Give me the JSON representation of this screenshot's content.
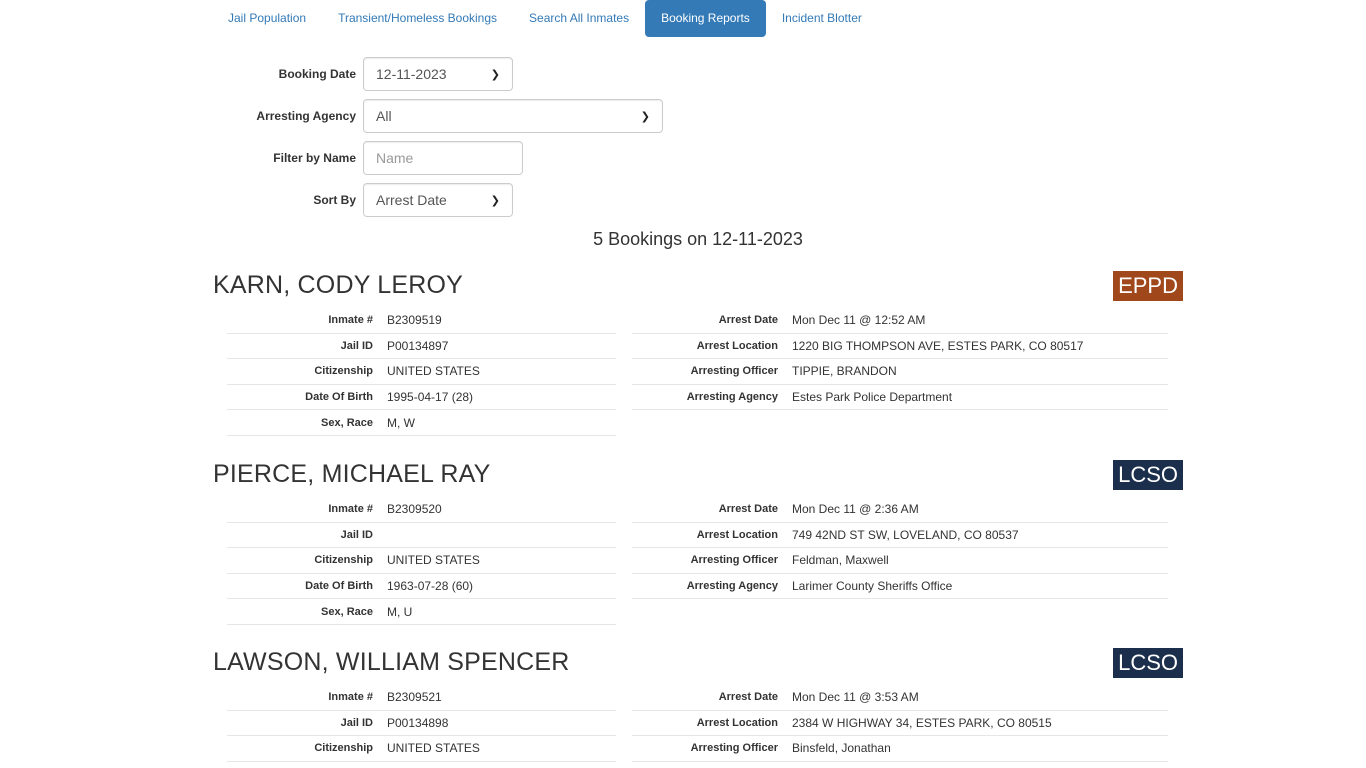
{
  "nav": {
    "tabs": [
      {
        "label": "Jail Population",
        "active": false
      },
      {
        "label": "Transient/Homeless Bookings",
        "active": false
      },
      {
        "label": "Search All Inmates",
        "active": false
      },
      {
        "label": "Booking Reports",
        "active": true
      },
      {
        "label": "Incident Blotter",
        "active": false
      }
    ]
  },
  "filters": {
    "booking_date": {
      "label": "Booking Date",
      "value": "12-11-2023"
    },
    "arresting_agency": {
      "label": "Arresting Agency",
      "value": "All"
    },
    "filter_name": {
      "label": "Filter by Name",
      "placeholder": "Name"
    },
    "sort_by": {
      "label": "Sort By",
      "value": "Arrest Date"
    }
  },
  "summary": "5 Bookings on 12-11-2023",
  "colors": {
    "accent": "#337ab7",
    "eppd_badge": "#a0471b",
    "lcso_badge": "#1b2f4d"
  },
  "labels": {
    "inmate": "Inmate #",
    "jail_id": "Jail ID",
    "citizenship": "Citizenship",
    "dob": "Date Of Birth",
    "sex_race": "Sex, Race",
    "arrest_date": "Arrest Date",
    "arrest_location": "Arrest Location",
    "arresting_officer": "Arresting Officer",
    "arresting_agency": "Arresting Agency"
  },
  "bookings": [
    {
      "name": "KARN, CODY LEROY",
      "agency_badge": "EPPD",
      "inmate": "B2309519",
      "jail_id": "P00134897",
      "citizenship": "UNITED STATES",
      "dob": "1995-04-17 (28)",
      "sex_race": "M, W",
      "arrest_date": "Mon Dec 11 @ 12:52 AM",
      "arrest_location": "1220 BIG THOMPSON AVE, ESTES PARK, CO 80517",
      "arresting_officer": "TIPPIE, BRANDON",
      "arresting_agency": "Estes Park Police Department"
    },
    {
      "name": "PIERCE, MICHAEL RAY",
      "agency_badge": "LCSO",
      "inmate": "B2309520",
      "jail_id": "",
      "citizenship": "UNITED STATES",
      "dob": "1963-07-28 (60)",
      "sex_race": "M, U",
      "arrest_date": "Mon Dec 11 @ 2:36 AM",
      "arrest_location": "749 42ND ST SW, LOVELAND, CO 80537",
      "arresting_officer": "Feldman, Maxwell",
      "arresting_agency": "Larimer County Sheriffs Office"
    },
    {
      "name": "LAWSON, WILLIAM SPENCER",
      "agency_badge": "LCSO",
      "inmate": "B2309521",
      "jail_id": "P00134898",
      "citizenship": "UNITED STATES",
      "arrest_date": "Mon Dec 11 @ 3:53 AM",
      "arrest_location": "2384 W HIGHWAY 34, ESTES PARK, CO 80515",
      "arresting_officer": "Binsfeld, Jonathan"
    }
  ]
}
